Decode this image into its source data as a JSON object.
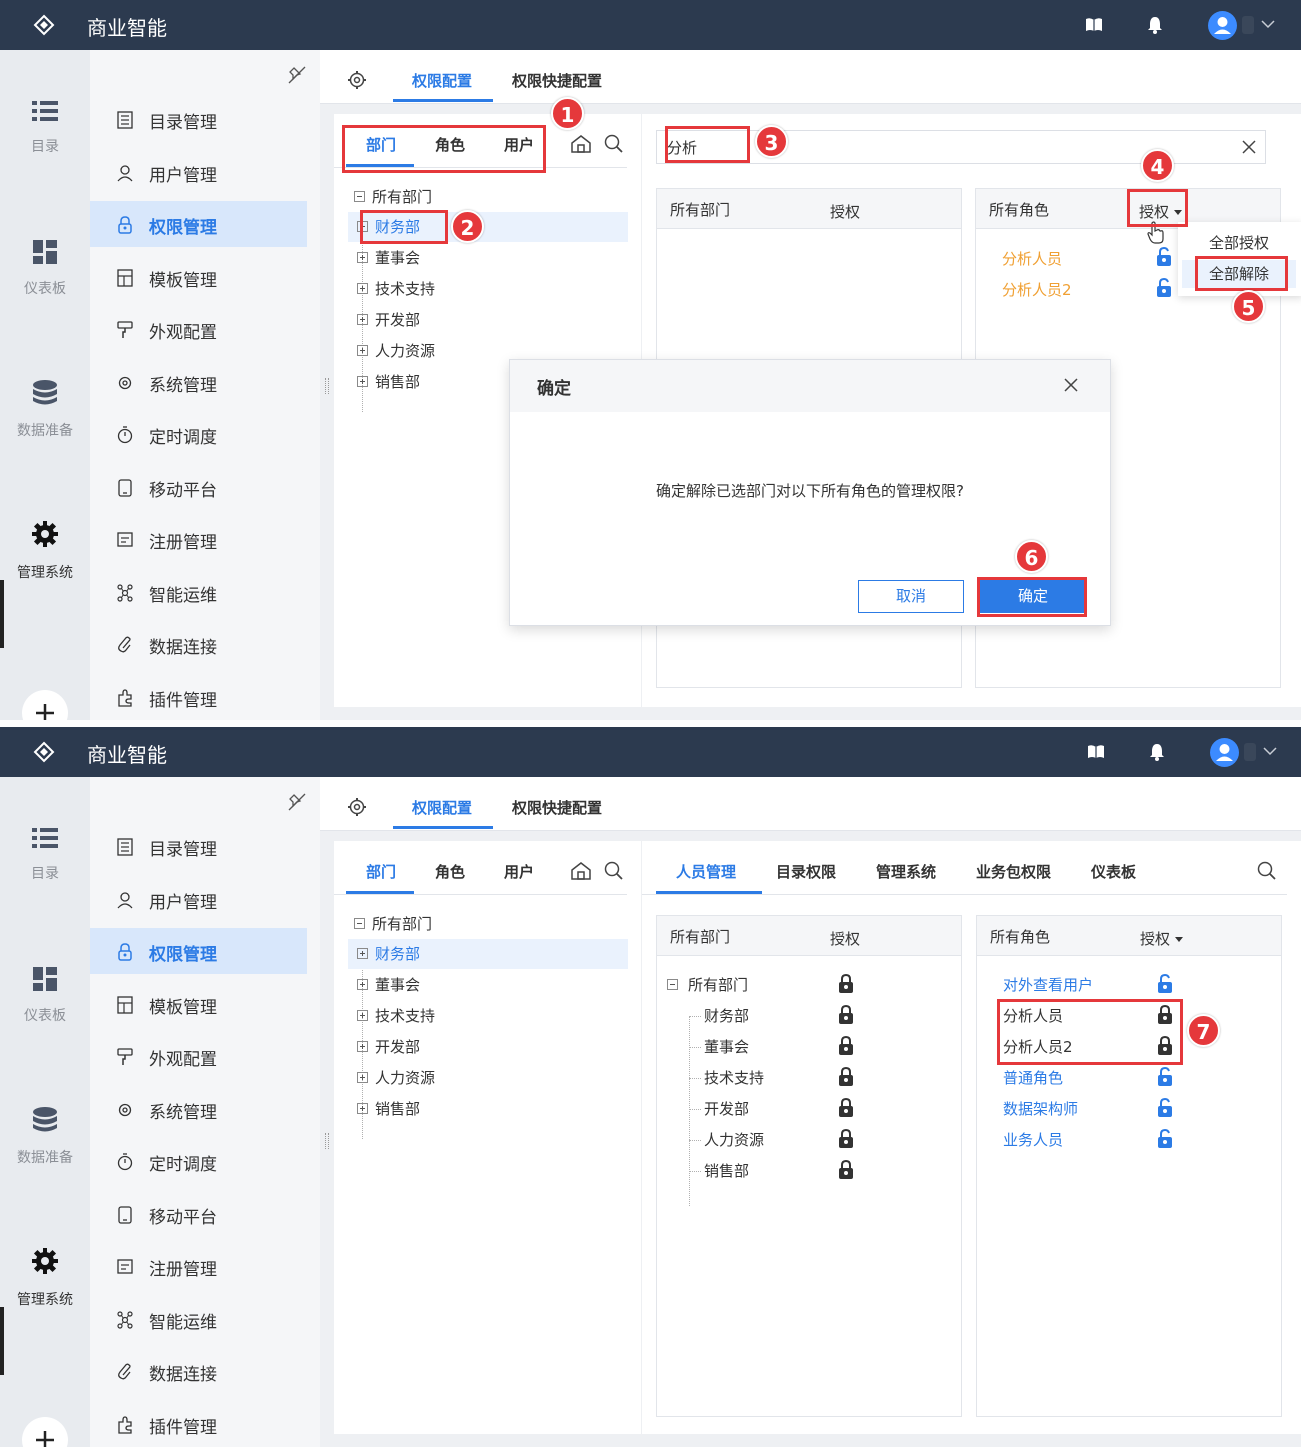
{
  "header": {
    "title": "商业智能"
  },
  "rail": {
    "items": [
      {
        "label": "目录",
        "icon": "list-icon"
      },
      {
        "label": "仪表板",
        "icon": "dashboard-icon"
      },
      {
        "label": "数据准备",
        "icon": "database-icon"
      },
      {
        "label": "管理系统",
        "icon": "gear-icon",
        "active": true
      }
    ]
  },
  "sidebar": {
    "items": [
      {
        "label": "目录管理",
        "icon": "catalog-icon"
      },
      {
        "label": "用户管理",
        "icon": "user-icon"
      },
      {
        "label": "权限管理",
        "icon": "lock-icon",
        "active": true
      },
      {
        "label": "模板管理",
        "icon": "template-icon"
      },
      {
        "label": "外观配置",
        "icon": "brush-icon"
      },
      {
        "label": "系统管理",
        "icon": "settings-icon"
      },
      {
        "label": "定时调度",
        "icon": "timer-icon"
      },
      {
        "label": "移动平台",
        "icon": "mobile-icon"
      },
      {
        "label": "注册管理",
        "icon": "register-icon"
      },
      {
        "label": "智能运维",
        "icon": "ops-icon"
      },
      {
        "label": "数据连接",
        "icon": "link-icon"
      },
      {
        "label": "插件管理",
        "icon": "plugin-icon"
      }
    ]
  },
  "top_tabs": {
    "permission_config": "权限配置",
    "quick_config": "权限快捷配置"
  },
  "left_tabs": {
    "dept": "部门",
    "role": "角色",
    "user": "用户"
  },
  "tree": {
    "root": "所有部门",
    "children": [
      "财务部",
      "董事会",
      "技术支持",
      "开发部",
      "人力资源",
      "销售部"
    ],
    "selected": "财务部"
  },
  "screen1": {
    "search_value": "分析",
    "col_left": {
      "head_name": "所有部门",
      "head_auth": "授权"
    },
    "col_right": {
      "head_name": "所有角色",
      "head_auth": "授权"
    },
    "roles": [
      "分析人员",
      "分析人员2"
    ],
    "dropdown": {
      "grant_all": "全部授权",
      "revoke_all": "全部解除"
    },
    "modal": {
      "title": "确定",
      "message": "确定解除已选部门对以下所有角色的管理权限?",
      "cancel": "取消",
      "ok": "确定"
    }
  },
  "screen2": {
    "tabs": [
      "人员管理",
      "目录权限",
      "管理系统",
      "业务包权限",
      "仪表板"
    ],
    "col_left": {
      "head_name": "所有部门",
      "head_auth": "授权"
    },
    "col_right": {
      "head_name": "所有角色",
      "head_auth": "授权"
    },
    "dept_root": "所有部门",
    "depts": [
      "财务部",
      "董事会",
      "技术支持",
      "开发部",
      "人力资源",
      "销售部"
    ],
    "roles": [
      {
        "name": "对外查看用户",
        "locked": false
      },
      {
        "name": "分析人员",
        "locked": true
      },
      {
        "name": "分析人员2",
        "locked": true
      },
      {
        "name": "普通角色",
        "locked": false
      },
      {
        "name": "数据架构师",
        "locked": false
      },
      {
        "name": "业务人员",
        "locked": false
      }
    ]
  },
  "annotations": [
    "1",
    "2",
    "3",
    "4",
    "5",
    "6",
    "7"
  ],
  "colors": {
    "header": "#2c3a4f",
    "accent": "#2c7be5",
    "highlight": "#e5383b",
    "role_orange": "#f0a033"
  }
}
